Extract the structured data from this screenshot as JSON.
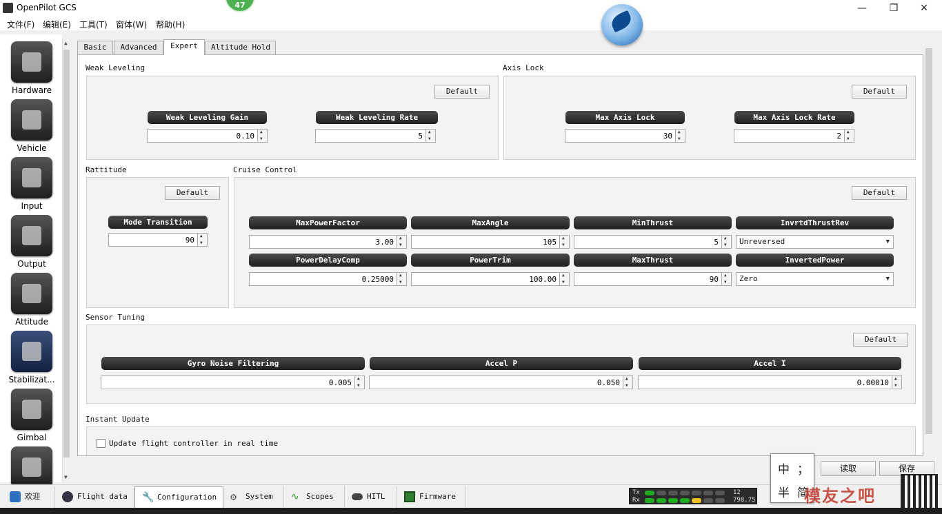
{
  "window": {
    "title": "OpenPilot GCS",
    "badge": "47",
    "minimize": "—",
    "maximize": "❐",
    "close": "✕"
  },
  "menubar": [
    "文件(F)",
    "编辑(E)",
    "工具(T)",
    "窗体(W)",
    "帮助(H)"
  ],
  "sidebar": {
    "items": [
      {
        "label": "Hardware",
        "icon": "chip-icon"
      },
      {
        "label": "Vehicle",
        "icon": "vehicle-icon"
      },
      {
        "label": "Input",
        "icon": "transmitter-icon"
      },
      {
        "label": "Output",
        "icon": "motor-icon"
      },
      {
        "label": "Attitude",
        "icon": "attitude-icon"
      },
      {
        "label": "Stabilizat...",
        "icon": "stabilization-icon"
      },
      {
        "label": "Gimbal",
        "icon": "camera-icon"
      },
      {
        "label": "",
        "icon": "gauge-icon"
      }
    ]
  },
  "tabs": [
    "Basic",
    "Advanced",
    "Expert",
    "Altitude Hold"
  ],
  "active_tab": "Expert",
  "weak_leveling": {
    "title": "Weak Leveling",
    "default": "Default",
    "gain_label": "Weak Leveling Gain",
    "gain_value": "0.10",
    "rate_label": "Weak Leveling Rate",
    "rate_value": "5"
  },
  "axis_lock": {
    "title": "Axis Lock",
    "default": "Default",
    "max_label": "Max Axis Lock",
    "max_value": "30",
    "rate_label": "Max Axis Lock Rate",
    "rate_value": "2"
  },
  "rattitude": {
    "title": "Rattitude",
    "default": "Default",
    "mode_label": "Mode Transition",
    "mode_value": "90"
  },
  "cruise_control": {
    "title": "Cruise Control",
    "default": "Default",
    "max_power_factor_label": "MaxPowerFactor",
    "max_power_factor_value": "3.00",
    "max_angle_label": "MaxAngle",
    "max_angle_value": "105",
    "min_thrust_label": "MinThrust",
    "min_thrust_value": "5",
    "invrtd_thrust_rev_label": "InvrtdThrustRev",
    "invrtd_thrust_rev_value": "Unreversed",
    "power_delay_comp_label": "PowerDelayComp",
    "power_delay_comp_value": "0.25000",
    "power_trim_label": "PowerTrim",
    "power_trim_value": "100.00",
    "max_thrust_label": "MaxThrust",
    "max_thrust_value": "90",
    "inverted_power_label": "InvertedPower",
    "inverted_power_value": "Zero"
  },
  "sensor_tuning": {
    "title": "Sensor Tuning",
    "default": "Default",
    "gyro_label": "Gyro Noise Filtering",
    "gyro_value": "0.005",
    "accel_p_label": "Accel P",
    "accel_p_value": "0.050",
    "accel_i_label": "Accel I",
    "accel_i_value": "0.00010"
  },
  "instant_update": {
    "title": "Instant Update",
    "checkbox_label": "Update flight controller in real time"
  },
  "actions": {
    "read": "读取",
    "save": "保存"
  },
  "bottom_tabs": [
    {
      "label": "欢迎",
      "icon": "bird-icon"
    },
    {
      "label": "Flight data",
      "icon": "flight-data-icon"
    },
    {
      "label": "Configuration",
      "icon": "wrench-icon"
    },
    {
      "label": "System",
      "icon": "gear-icon"
    },
    {
      "label": "Scopes",
      "icon": "scope-icon"
    },
    {
      "label": "HITL",
      "icon": "gamepad-icon"
    },
    {
      "label": "Firmware",
      "icon": "firmware-icon"
    }
  ],
  "active_bottom_tab": "Configuration",
  "telemetry": {
    "tx_label": "Tx",
    "rx_label": "Rx",
    "tx_value": "12",
    "rx_value": "798.75"
  },
  "ime": {
    "lang": "中",
    "punct": "；",
    "width": "半",
    "script": "简"
  },
  "watermark": "模友之吧"
}
